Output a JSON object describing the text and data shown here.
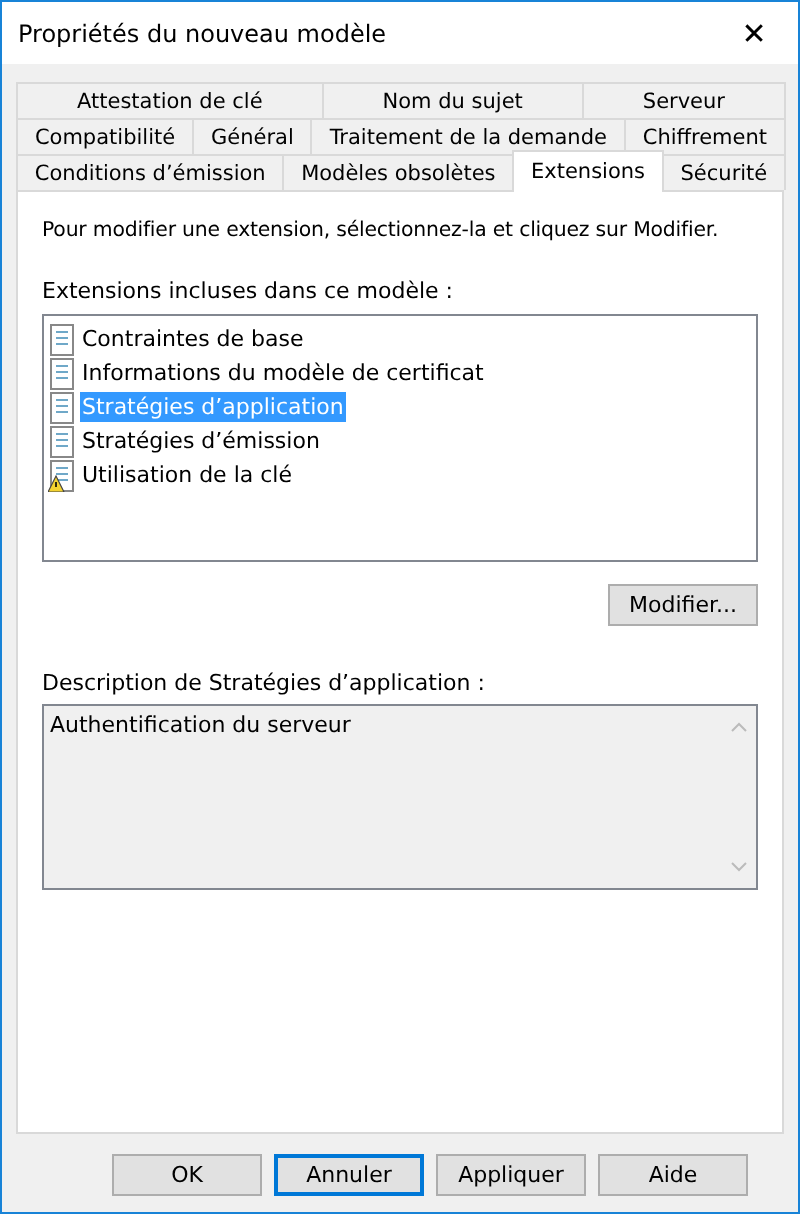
{
  "window": {
    "title": "Propriétés du nouveau modèle",
    "close": "✕"
  },
  "tab_rows": [
    [
      {
        "label": "Attestation de clé",
        "selected": false
      },
      {
        "label": "Nom du sujet",
        "selected": false
      },
      {
        "label": "Serveur",
        "selected": false
      }
    ],
    [
      {
        "label": "Compatibilité",
        "selected": false
      },
      {
        "label": "Général",
        "selected": false
      },
      {
        "label": "Traitement de la demande",
        "selected": false
      },
      {
        "label": "Chiffrement",
        "selected": false
      }
    ],
    [
      {
        "label": "Conditions d’émission",
        "selected": false
      },
      {
        "label": "Modèles obsolètes",
        "selected": false
      },
      {
        "label": "Extensions",
        "selected": true
      },
      {
        "label": "Sécurité",
        "selected": false
      }
    ]
  ],
  "instruction": "Pour modifier une extension, sélectionnez-la et cliquez sur Modifier.",
  "extensions": {
    "label": "Extensions incluses dans ce modèle :",
    "items": [
      {
        "label": "Contraintes de base",
        "kind": "document",
        "selected": false
      },
      {
        "label": "Informations du modèle de certificat",
        "kind": "document",
        "selected": false
      },
      {
        "label": "Stratégies d’application",
        "kind": "document",
        "selected": true
      },
      {
        "label": "Stratégies d’émission",
        "kind": "document",
        "selected": false
      },
      {
        "label": "Utilisation de la clé",
        "kind": "warning",
        "selected": false
      }
    ]
  },
  "modify_button": "Modifier...",
  "description": {
    "label": "Description de Stratégies d’application :",
    "text": "Authentification du serveur"
  },
  "buttons": [
    {
      "label": "OK",
      "focused": false
    },
    {
      "label": "Annuler",
      "focused": true
    },
    {
      "label": "Appliquer",
      "focused": false
    },
    {
      "label": "Aide",
      "focused": false
    }
  ]
}
